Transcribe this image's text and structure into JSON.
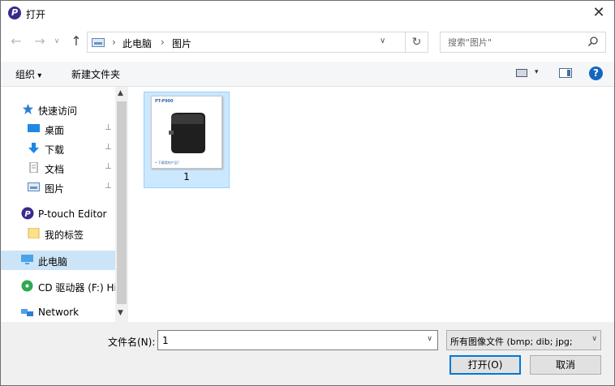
{
  "window": {
    "title": "打开",
    "app_icon_letter": "P",
    "close_glyph": "✕"
  },
  "navigation": {
    "back_glyph": "←",
    "forward_glyph": "→",
    "recent_glyph": "∨",
    "up_glyph": "↑",
    "breadcrumb": [
      "此电脑",
      "图片"
    ],
    "breadcrumb_separator": "›",
    "dropdown_glyph": "∨",
    "refresh_glyph": "↻",
    "search_placeholder": "搜索\"图片\""
  },
  "toolbar": {
    "organize_label": "组织",
    "new_folder_label": "新建文件夹",
    "view_dropdown_glyph": "▾",
    "help_glyph": "?"
  },
  "sidebar": {
    "items": [
      {
        "label": "快速访问",
        "icon": "star-icon"
      },
      {
        "label": "桌面",
        "icon": "desktop-icon",
        "pinned": true
      },
      {
        "label": "下载",
        "icon": "download-icon",
        "pinned": true
      },
      {
        "label": "文档",
        "icon": "document-icon",
        "pinned": true
      },
      {
        "label": "图片",
        "icon": "pictures-icon",
        "pinned": true
      },
      {
        "label": "P-touch Editor",
        "icon": "ptouch-icon"
      },
      {
        "label": "我的标签",
        "icon": "folder-icon"
      },
      {
        "label": "此电脑",
        "icon": "computer-icon",
        "selected": true
      },
      {
        "label": "CD 驱动器 (F:) Hi",
        "icon": "cd-drive-icon"
      },
      {
        "label": "Network",
        "icon": "network-icon"
      }
    ],
    "pin_glyph": "📌"
  },
  "files": [
    {
      "name": "1",
      "thumbnail": {
        "model": "PT-P900",
        "footer": "• 下载我的产品?"
      }
    }
  ],
  "footer": {
    "filename_label": "文件名(N):",
    "filename_value": "1",
    "filter_value": "所有图像文件 (bmp; dib; jpg;",
    "open_label": "打开(O)",
    "cancel_label": "取消"
  },
  "colors": {
    "selection": "#cce8ff",
    "nav_selection": "#cce4f7",
    "accent": "#0078d7"
  }
}
